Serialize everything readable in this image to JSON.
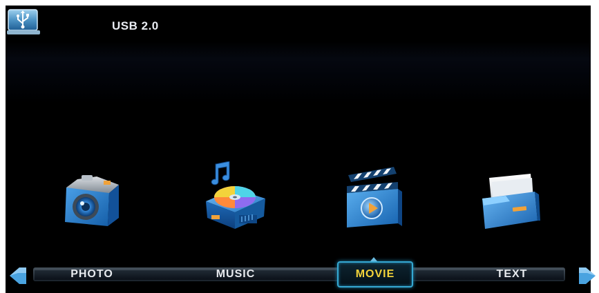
{
  "header": {
    "source_label": "USB 2.0",
    "badge_icon": "usb-drive-icon"
  },
  "tiles": [
    {
      "id": "photo",
      "icon": "camera-icon"
    },
    {
      "id": "music",
      "icon": "music-disc-icon"
    },
    {
      "id": "movie",
      "icon": "clapperboard-icon"
    },
    {
      "id": "text",
      "icon": "document-folder-icon"
    }
  ],
  "nav": {
    "items": [
      {
        "label": "PHOTO"
      },
      {
        "label": "MUSIC"
      },
      {
        "label": "MOVIE"
      },
      {
        "label": "TEXT"
      }
    ],
    "selected": "MOVIE",
    "prev_icon": "arrow-left-icon",
    "next_icon": "arrow-right-icon"
  },
  "colors": {
    "selected_text": "#f2d23a",
    "selected_border": "#35a8d2",
    "icon_blue": "#1f76c8",
    "label_text": "#e7eaee"
  }
}
